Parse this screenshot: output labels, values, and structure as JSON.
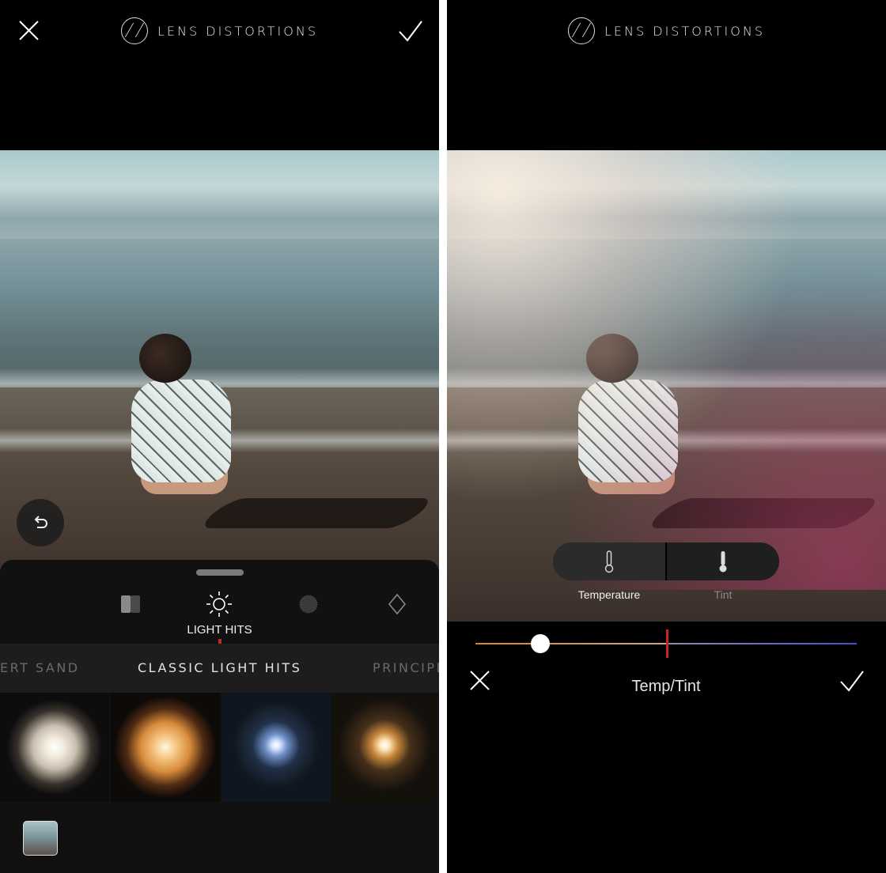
{
  "left_panel": {
    "header": {
      "title": "LENS DISTORTIONS"
    },
    "categories": {
      "items": [
        {
          "icon": "gradient-split-icon",
          "label": ""
        },
        {
          "icon": "sun-icon",
          "label": "LIGHT HITS"
        },
        {
          "icon": "texture-dot-icon",
          "label": ""
        },
        {
          "icon": "diamond-icon",
          "label": ""
        }
      ],
      "selected_label": "LIGHT HITS"
    },
    "presets": {
      "prev": "ERT SAND",
      "current": "CLASSIC LIGHT HITS",
      "next": "PRINCIPL"
    },
    "thumbnails": [
      {
        "name": "white-glow"
      },
      {
        "name": "warm-glow"
      },
      {
        "name": "blue-flare"
      },
      {
        "name": "warm-flare"
      }
    ]
  },
  "right_panel": {
    "header": {
      "title": "LENS DISTORTIONS"
    },
    "segments": {
      "temperature_label": "Temperature",
      "tint_label": "Tint",
      "active": "Temperature"
    },
    "slider": {
      "value_fraction": 0.17,
      "start_color": "#d9852a",
      "end_color": "#4a4ad0"
    },
    "bottom": {
      "title": "Temp/Tint"
    }
  },
  "colors": {
    "accent_marker": "#c2261c",
    "sheet": "#111111"
  }
}
